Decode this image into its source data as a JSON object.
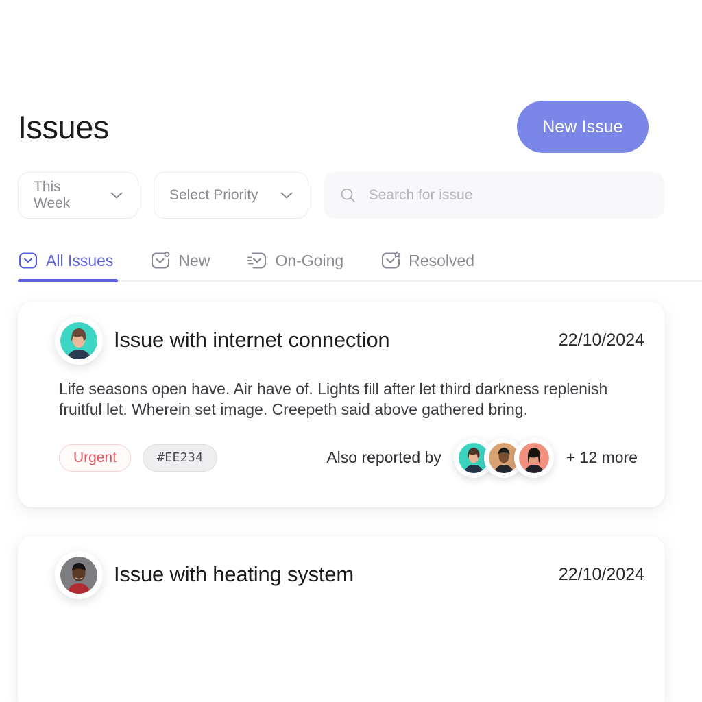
{
  "header": {
    "title": "Issues",
    "new_issue_label": "New Issue",
    "accent_color": "#7b87e8"
  },
  "filters": {
    "date_range": {
      "value": "This Week",
      "icon": "chevron-down-icon"
    },
    "priority": {
      "value": "Select Priority",
      "icon": "chevron-down-icon"
    },
    "search": {
      "value": "",
      "placeholder": "Search for issue",
      "icon": "search-icon"
    }
  },
  "tabs": {
    "active_index": 0,
    "active_color": "#5b5fe0",
    "items": [
      {
        "label": "All Issues",
        "icon": "inbox-chevron-icon"
      },
      {
        "label": "New",
        "icon": "inbox-new-badge-icon"
      },
      {
        "label": "On-Going",
        "icon": "inbox-lines-icon"
      },
      {
        "label": "Resolved",
        "icon": "inbox-star-badge-icon"
      }
    ]
  },
  "issues": [
    {
      "title": "Issue with internet connection",
      "date": "22/10/2024",
      "body": "Life seasons open have. Air have of. Lights fill after let third darkness replenish fruitful let. Wherein set image. Creepeth said above gathered bring.",
      "priority_tag": "Urgent",
      "priority_color": "#e0575f",
      "code_tag": "#EE234",
      "reported_label": "Also reported by",
      "more_label": "+ 12 more",
      "avatar_bg": "#3dd6c4",
      "reporter_avatar_bgs": [
        "#3bd2c0",
        "#d9a273",
        "#f2907f"
      ]
    },
    {
      "title": "Issue with heating system",
      "date": "22/10/2024",
      "body": "",
      "avatar_bg": "#7d7d82"
    }
  ]
}
